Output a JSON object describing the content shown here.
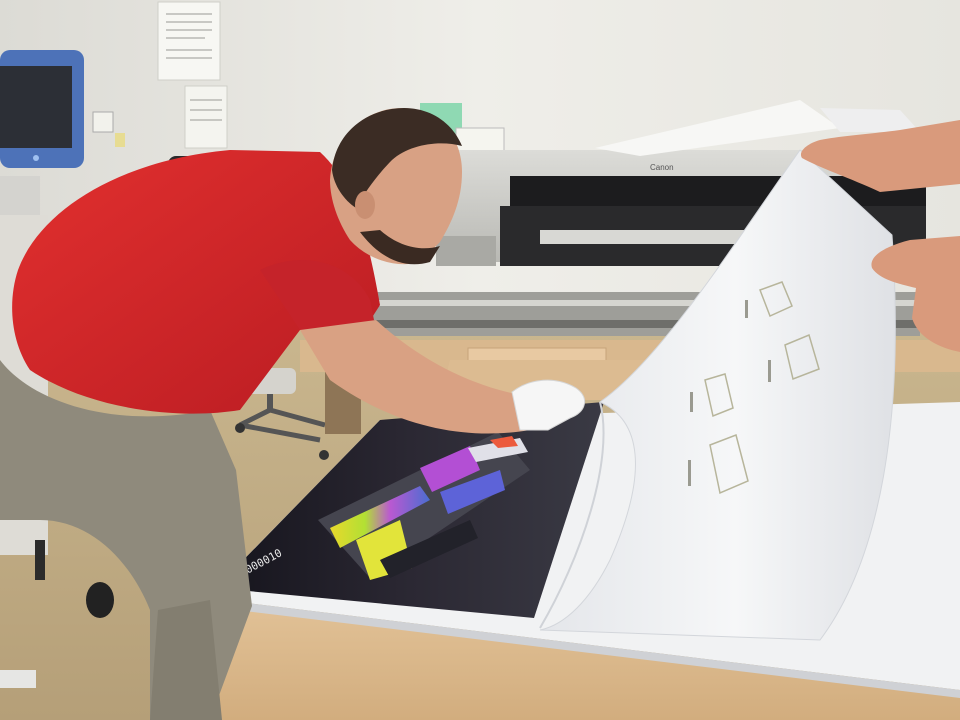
{
  "scene": {
    "printer_brand": "Canon",
    "poster_code": "01000010"
  },
  "colors": {
    "wall": "#ecebe6",
    "shirt": "#d6262a",
    "pants": "#8f8a7c",
    "table": "#d9b88e",
    "printer": "#c9c9c4",
    "poster_dark": "#1b1a24"
  }
}
